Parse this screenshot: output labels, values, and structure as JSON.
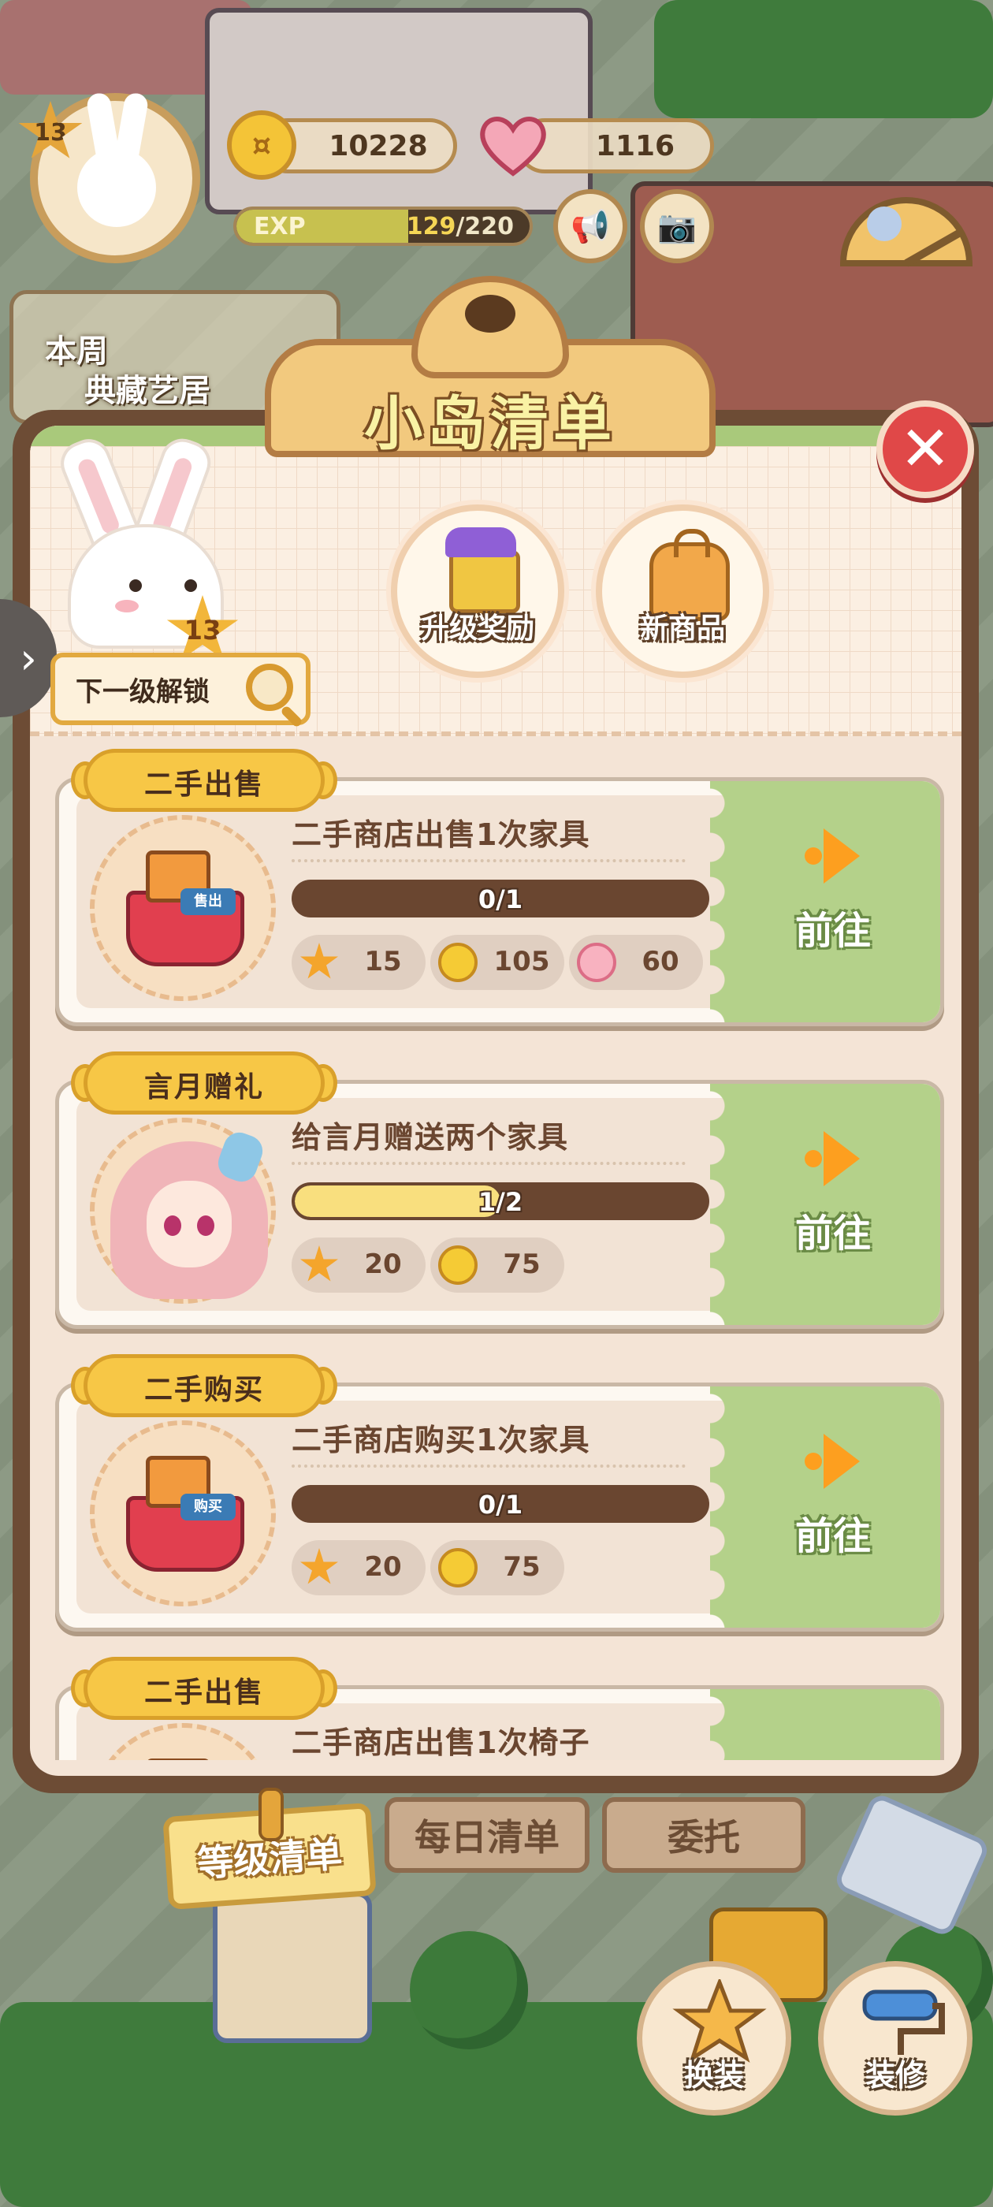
{
  "hud": {
    "level": "13",
    "coins": "10228",
    "hearts": "1116",
    "exp_label": "EXP",
    "exp_current": "129",
    "exp_total": "/220",
    "exp_progress": 0.586,
    "weekly_label_1": "本周",
    "weekly_label_2": "典藏艺居"
  },
  "modal": {
    "title": "小岛清单",
    "mascot_level": "13",
    "next_unlock": "下一级解锁",
    "buttons": {
      "upgrade_reward": "升级奖励",
      "new_items": "新商品"
    }
  },
  "quests": [
    {
      "tag": "二手出售",
      "title": "二手商店出售1次家具",
      "progress_text": "0/1",
      "progress": 0,
      "sticker": "售出",
      "rewards": [
        {
          "icon": "star-icon",
          "value": "15"
        },
        {
          "icon": "coin-icon",
          "value": "105"
        },
        {
          "icon": "heart-icon",
          "value": "60"
        }
      ],
      "go": "前往"
    },
    {
      "tag": "言月赠礼",
      "title": "给言月赠送两个家具",
      "progress_text": "1/2",
      "progress": 0.5,
      "rewards": [
        {
          "icon": "star-icon",
          "value": "20"
        },
        {
          "icon": "coin-icon",
          "value": "75"
        }
      ],
      "go": "前往"
    },
    {
      "tag": "二手购买",
      "title": "二手商店购买1次家具",
      "progress_text": "0/1",
      "progress": 0,
      "sticker": "购买",
      "rewards": [
        {
          "icon": "star-icon",
          "value": "20"
        },
        {
          "icon": "coin-icon",
          "value": "75"
        }
      ],
      "go": "前往"
    },
    {
      "tag": "二手出售",
      "title": "二手商店出售1次椅子"
    }
  ],
  "tabs": {
    "level_list": "等级清单",
    "daily_list": "每日清单",
    "commission": "委托"
  },
  "bottom": {
    "dress_up": "换装",
    "decorate": "装修"
  },
  "colors": {
    "modal_frame": "#6d4c35",
    "go_green": "#b4d18a",
    "tag_yellow": "#f7c746",
    "close_red": "#e04848"
  }
}
